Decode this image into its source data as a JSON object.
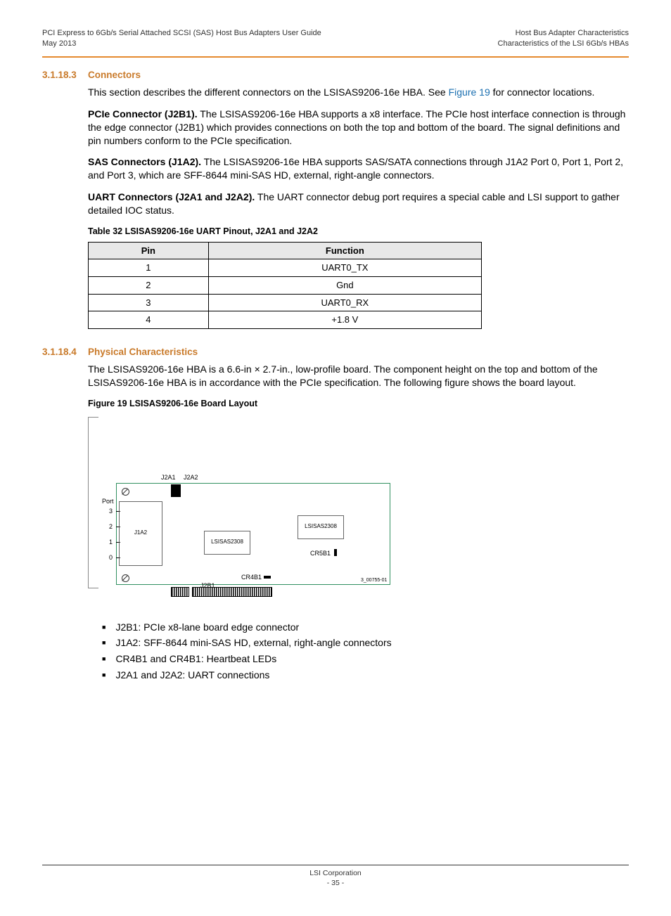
{
  "header": {
    "left1": "PCI Express to 6Gb/s Serial Attached SCSI (SAS) Host Bus Adapters User Guide",
    "left2": "May 2013",
    "right1": "Host Bus Adapter Characteristics",
    "right2": "Characteristics of the LSI 6Gb/s HBAs"
  },
  "sections": [
    {
      "num": "3.1.18.3",
      "title": "Connectors"
    },
    {
      "num": "3.1.18.4",
      "title": "Physical Characteristics"
    }
  ],
  "connectors_intro_a": "This section describes the different connectors on the LSISAS9206-16e HBA. See ",
  "connectors_intro_link": "Figure 19",
  "connectors_intro_b": " for connector locations.",
  "pcie_head": "PCIe Connector (J2B1).",
  "pcie_body": "  The LSISAS9206-16e HBA supports a x8 interface. The PCIe host interface connection is through the edge connector (J2B1) which provides connections on both the top and bottom of the board. The signal definitions and pin numbers conform to the PCIe specification.",
  "sas_head": "SAS Connectors (J1A2).",
  "sas_body": "  The LSISAS9206-16e HBA supports SAS/SATA connections through J1A2 Port 0, Port 1, Port 2, and Port 3, which are SFF-8644 mini-SAS HD, external, right-angle connectors.",
  "uart_head": "UART Connectors (J2A1 and J2A2).",
  "uart_body": " The UART connector debug port requires a special cable and LSI support to gather detailed IOC status.",
  "table_caption": "Table 32  LSISAS9206-16e UART Pinout, J2A1 and J2A2",
  "table_headers": [
    "Pin",
    "Function"
  ],
  "table_rows": [
    [
      "1",
      "UART0_TX"
    ],
    [
      "2",
      "Gnd"
    ],
    [
      "3",
      "UART0_RX"
    ],
    [
      "4",
      "+1.8 V"
    ]
  ],
  "phys_body": "The LSISAS9206-16e HBA is a 6.6-in × 2.7-in., low-profile board. The component height on the top and bottom of the LSISAS9206-16e HBA is in accordance with the PCIe specification. The following figure shows the board layout.",
  "figure_caption": "Figure 19  LSISAS9206-16e Board Layout",
  "diagram": {
    "port": "Port",
    "p3": "3",
    "p2": "2",
    "p1": "1",
    "p0": "0",
    "j2a1": "J2A1",
    "j2a2": "J2A2",
    "j1a2": "J1A2",
    "chip1": "LSISAS2308",
    "chip2": "LSISAS2308",
    "j2b1": "J2B1",
    "cr4b1": "CR4B1",
    "cr5b1": "CR5B1",
    "partno": "3_00755-01"
  },
  "bullets": [
    "J2B1: PCIe x8-lane board edge connector",
    "J1A2: SFF-8644 mini-SAS HD, external, right-angle connectors",
    "CR4B1 and CR4B1: Heartbeat LEDs",
    "J2A1 and J2A2: UART connections"
  ],
  "footer": {
    "line1": "LSI Corporation",
    "line2": "- 35 -"
  }
}
